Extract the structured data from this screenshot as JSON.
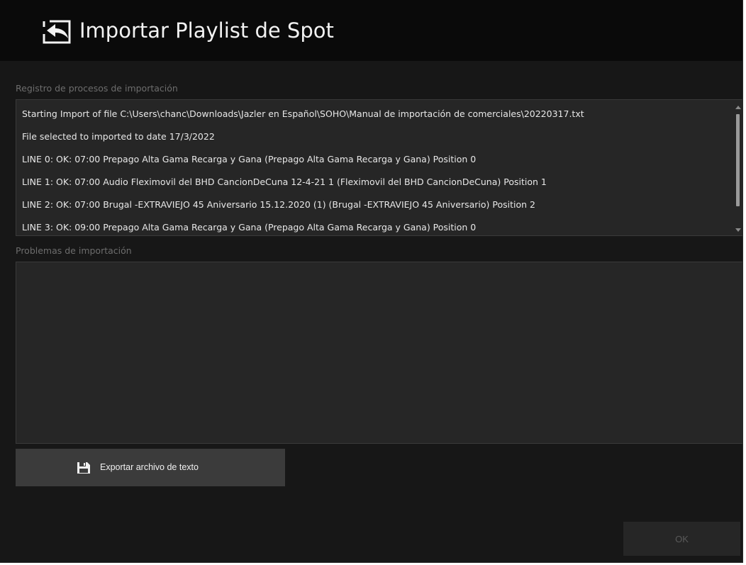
{
  "window": {
    "title": "Importar Playlist de Spot"
  },
  "log_section": {
    "label": "Registro de procesos de importación",
    "lines": [
      "Starting Import of file C:\\Users\\chanc\\Downloads\\Jazler en Español\\SOHO\\Manual de importación de comerciales\\20220317.txt",
      "File selected to imported to date 17/3/2022",
      "LINE 0: OK: 07:00 Prepago Alta Gama Recarga y Gana (Prepago Alta Gama Recarga y Gana) Position 0",
      "LINE 1: OK: 07:00 Audio Fleximovil del BHD CancionDeCuna 12-4-21  1 (Fleximovil del BHD CancionDeCuna) Position 1",
      "LINE 2: OK: 07:00 Brugal -EXTRAVIEJO 45 Aniversario 15.12.2020 (1) (Brugal -EXTRAVIEJO 45 Aniversario) Position 2",
      "LINE 3: OK: 09:00 Prepago Alta Gama Recarga y Gana (Prepago Alta Gama Recarga y Gana) Position 0"
    ]
  },
  "problems_section": {
    "label": "Problemas de importación"
  },
  "export_button": {
    "label": "Exportar archivo de texto",
    "icon": "floppy-disk-icon"
  },
  "ok_button": {
    "label": "OK"
  },
  "header_icon": "import-arrow-icon",
  "colors": {
    "window_bg": "#171717",
    "header_bg": "#0a0a0a",
    "panel_bg": "#262626",
    "button_bg": "#3b3b3b",
    "disabled_text": "#5a5a5a"
  }
}
